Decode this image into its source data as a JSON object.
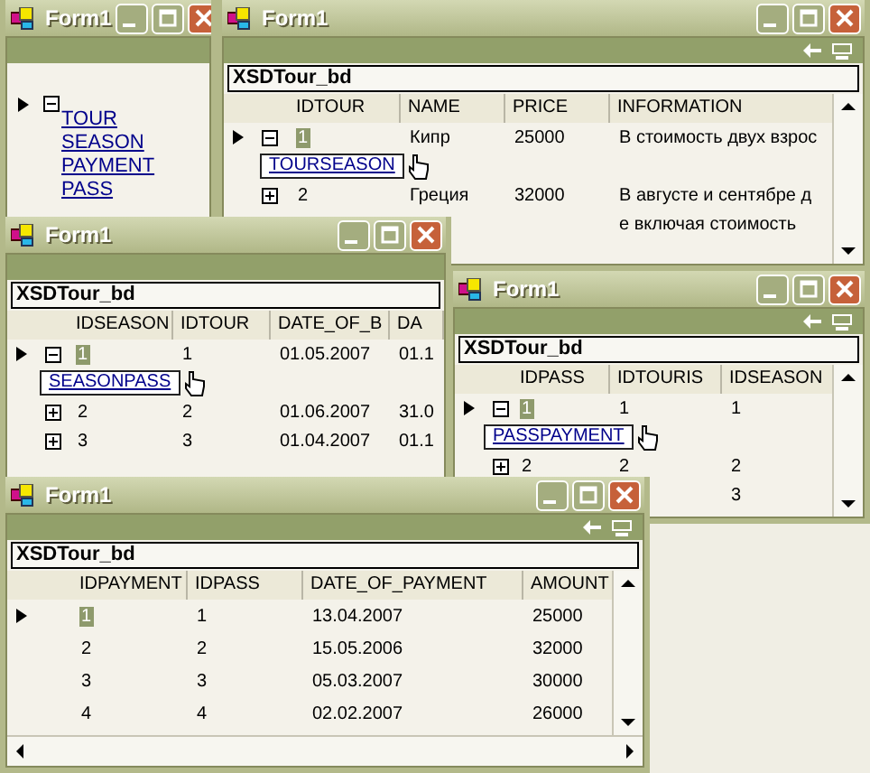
{
  "windows": [
    {
      "kind": "tree",
      "title": "Form1",
      "navigation_icons": false,
      "links": [
        "TOUR",
        "SEASON",
        "PAYMENT",
        "PASS"
      ]
    },
    {
      "kind": "grid",
      "title": "Form1",
      "navigation_icons": true,
      "caption": "XSDTour_bd",
      "columns": [
        "IDTOUR",
        "NAME",
        "PRICE",
        "INFORMATION"
      ],
      "rows": [
        {
          "cells": [
            "1",
            "Кипр",
            "25000",
            "В стоимость двух взрос"
          ],
          "selected": true,
          "expanded": true,
          "relation": "TOURSEASON"
        },
        {
          "cells": [
            "2",
            "Греция",
            "32000",
            "В августе и сентябре д"
          ],
          "selected": false,
          "expanded": false
        },
        {
          "cells": [
            "",
            "",
            "",
            "е включая стоимость"
          ]
        }
      ]
    },
    {
      "kind": "grid",
      "title": "Form1",
      "navigation_icons": false,
      "caption": "XSDTour_bd",
      "columns": [
        "IDSEASON",
        "IDTOUR",
        "DATE_OF_B",
        "DA"
      ],
      "rows": [
        {
          "cells": [
            "1",
            "1",
            "01.05.2007",
            "01.1"
          ],
          "selected": true,
          "expanded": true,
          "relation": "SEASONPASS"
        },
        {
          "cells": [
            "2",
            "2",
            "01.06.2007",
            "31.0"
          ],
          "selected": false,
          "expanded": false
        },
        {
          "cells": [
            "3",
            "3",
            "01.04.2007",
            "01.1"
          ],
          "selected": false,
          "expanded": false
        }
      ]
    },
    {
      "kind": "grid",
      "title": "Form1",
      "navigation_icons": true,
      "caption": "XSDTour_bd",
      "columns": [
        "IDPASS",
        "IDTOURIS",
        "IDSEASON"
      ],
      "rows": [
        {
          "cells": [
            "1",
            "1",
            "1"
          ],
          "selected": true,
          "expanded": true,
          "relation": "PASSPAYMENT"
        },
        {
          "cells": [
            "2",
            "2",
            "2"
          ],
          "selected": false,
          "expanded": false
        },
        {
          "cells": [
            "",
            "",
            "3"
          ]
        }
      ]
    },
    {
      "kind": "grid",
      "title": "Form1",
      "navigation_icons": true,
      "caption": "XSDTour_bd",
      "columns": [
        "IDPAYMENT",
        "IDPASS",
        "DATE_OF_PAYMENT",
        "AMOUNT"
      ],
      "rows": [
        {
          "cells": [
            "1",
            "1",
            "13.04.2007",
            "25000"
          ],
          "selected": true
        },
        {
          "cells": [
            "2",
            "2",
            "15.05.2006",
            "32000"
          ],
          "selected": false
        },
        {
          "cells": [
            "3",
            "3",
            "05.03.2007",
            "30000"
          ],
          "selected": false
        },
        {
          "cells": [
            "4",
            "4",
            "02.02.2007",
            "26000"
          ],
          "selected": false
        }
      ]
    }
  ]
}
